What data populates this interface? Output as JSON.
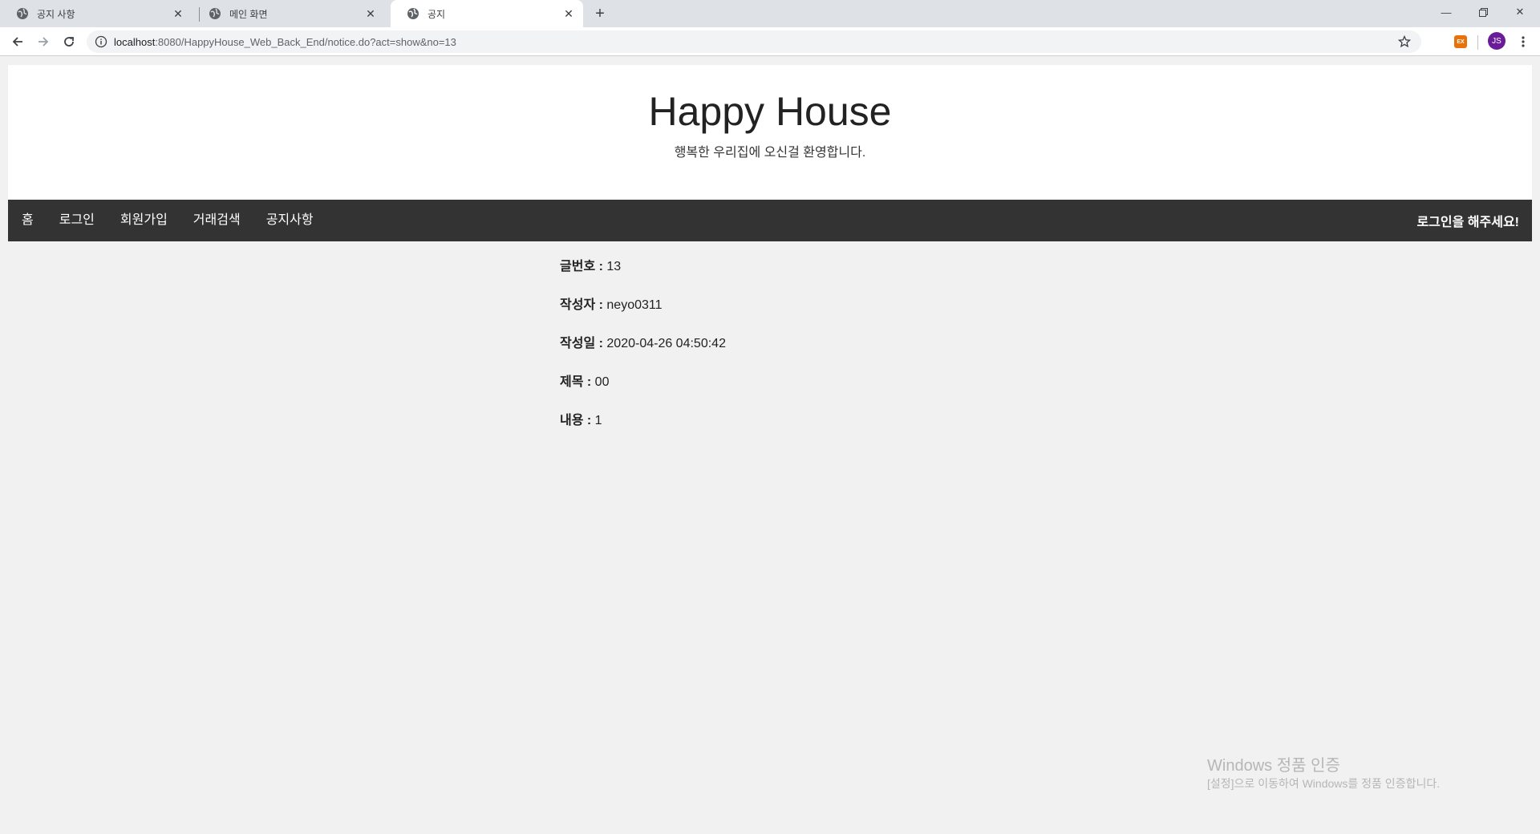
{
  "browser": {
    "tabs": [
      {
        "title": "공지 사항",
        "active": false
      },
      {
        "title": "메인 화면",
        "active": false
      },
      {
        "title": "공지",
        "active": true
      }
    ],
    "url_host": "localhost",
    "url_rest": ":8080/HappyHouse_Web_Back_End/notice.do?act=show&no=13",
    "extension_label": "EX",
    "avatar_initials": "JS"
  },
  "header": {
    "title": "Happy House",
    "subtitle": "행복한 우리집에 오신걸 환영합니다."
  },
  "nav": {
    "items": [
      "홈",
      "로그인",
      "회원가입",
      "거래검색",
      "공지사항"
    ],
    "right_text": "로그인을 해주세요!"
  },
  "notice": {
    "number_label": "글번호 :",
    "number_value": "13",
    "author_label": "작성자 :",
    "author_value": "neyo0311",
    "date_label": "작성일 :",
    "date_value": "2020-04-26 04:50:42",
    "subject_label": "제목 :",
    "subject_value": "00",
    "content_label": "내용 :",
    "content_value": "1"
  },
  "activation": {
    "line1": "Windows 정품 인증",
    "line2": "[설정]으로 이동하여 Windows를 정품 인증합니다."
  },
  "colors": {
    "nav_bg": "#333333",
    "page_bg": "#f1f1f1",
    "avatar_bg": "#6a1b9a",
    "extension_bg": "#e8710a"
  }
}
